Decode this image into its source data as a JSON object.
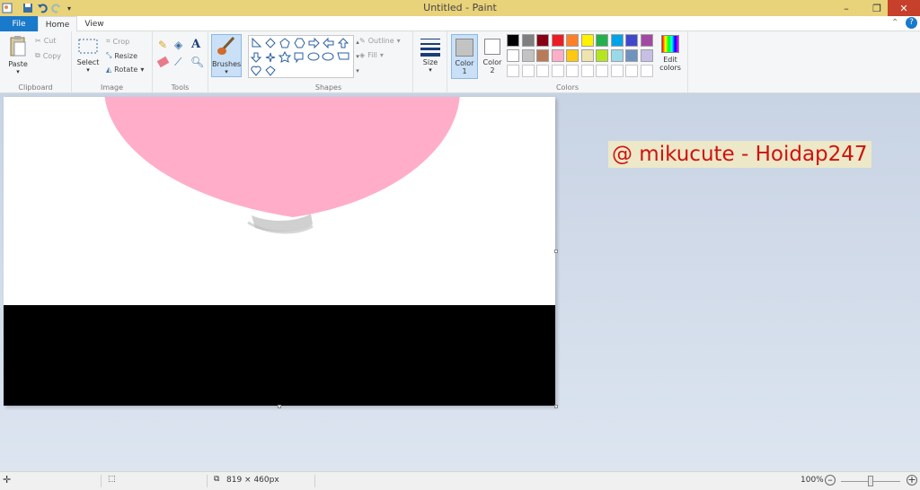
{
  "window": {
    "title": "Untitled - Paint"
  },
  "tabs": {
    "file": "File",
    "home": "Home",
    "view": "View"
  },
  "clipboard": {
    "paste": "Paste",
    "cut": "Cut",
    "copy": "Copy",
    "group": "Clipboard"
  },
  "image": {
    "select": "Select",
    "crop": "Crop",
    "resize": "Resize",
    "rotate": "Rotate",
    "group": "Image"
  },
  "tools": {
    "group": "Tools",
    "brushes": "Brushes"
  },
  "shapes": {
    "outline": "Outline",
    "fill": "Fill",
    "group": "Shapes"
  },
  "size": {
    "label": "Size"
  },
  "colors": {
    "color1": "Color",
    "color1_num": "1",
    "color2": "Color",
    "color2_num": "2",
    "edit": "Edit",
    "edit2": "colors",
    "group": "Colors",
    "color1_value": "#c3c3c3",
    "color2_value": "#ffffff",
    "palette_row1": [
      "#000000",
      "#7f7f7f",
      "#880015",
      "#ed1c24",
      "#ff7f27",
      "#fff200",
      "#22b14c",
      "#00a2e8",
      "#3f48cc",
      "#a349a4"
    ],
    "palette_row2": [
      "#ffffff",
      "#c3c3c3",
      "#b97a57",
      "#ffaec9",
      "#ffc90e",
      "#efe4b0",
      "#b5e61d",
      "#99d9ea",
      "#7092be",
      "#c8bfe7"
    ]
  },
  "canvas": {
    "watermark": "@ mikucute - Hoidap247",
    "balloon_color": "#ffadc9"
  },
  "status": {
    "dimensions": "819 × 460px",
    "zoom": "100%"
  }
}
